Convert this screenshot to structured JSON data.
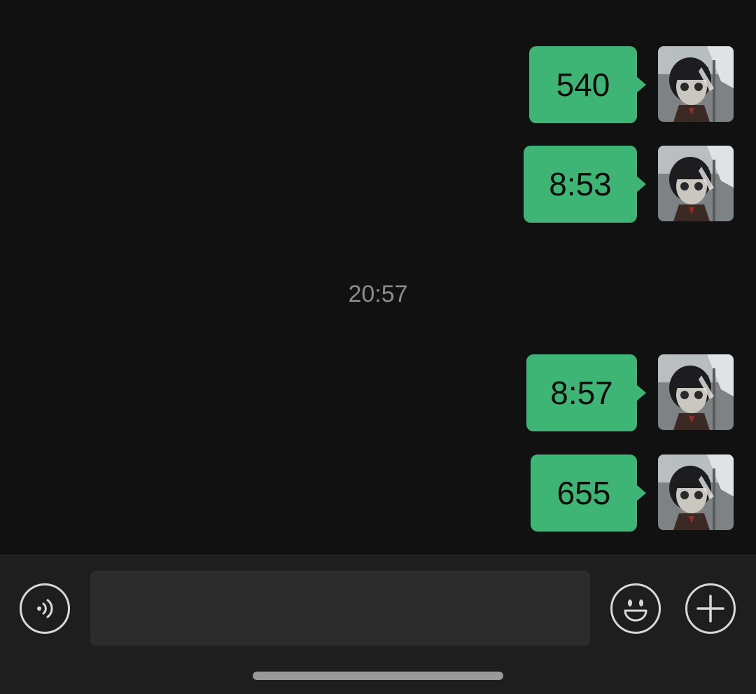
{
  "chat": {
    "messages": [
      {
        "text": "540",
        "sender": "self"
      },
      {
        "text": "8:53",
        "sender": "self"
      },
      {
        "text": "8:57",
        "sender": "self"
      },
      {
        "text": "655",
        "sender": "self"
      }
    ],
    "timestamp": "20:57"
  },
  "input_bar": {
    "message_value": "",
    "voice_icon": "voice-icon",
    "emoji_icon": "emoji-icon",
    "plus_icon": "plus-icon"
  },
  "colors": {
    "background": "#111111",
    "bubble": "#3eb575",
    "timestamp_text": "#8c8c8c",
    "input_bar": "#1e1e1e"
  }
}
